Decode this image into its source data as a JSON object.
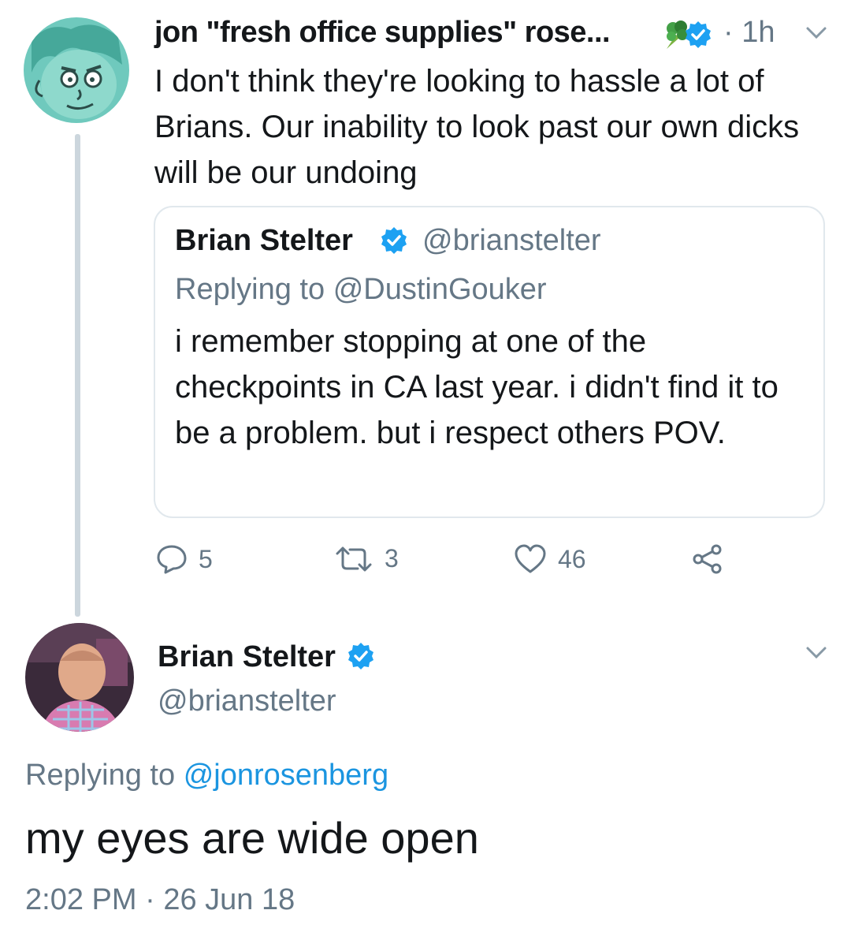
{
  "tweet1": {
    "display_name": "jon \"fresh office supplies\" rose...",
    "separator": "·",
    "time": "1h",
    "text": "I don't think they're looking to hassle a lot of Brians. Our inability to look past our own dicks will be our undoing",
    "quoted": {
      "display_name": "Brian Stelter",
      "handle": "@brianstelter",
      "replying_prefix": "Replying to",
      "replying_to": "@DustinGouker",
      "text": "i remember stopping at one of the checkpoints in CA last year. i didn't find it to be a problem. but i respect others POV."
    },
    "actions": {
      "replies": "5",
      "retweets": "3",
      "likes": "46"
    }
  },
  "tweet2": {
    "display_name": "Brian Stelter",
    "handle": "@brianstelter",
    "replying_prefix": "Replying to",
    "replying_to": "@jonrosenberg",
    "text": "my eyes are wide open",
    "time": "2:02 PM",
    "separator": "·",
    "date": "26 Jun 18"
  },
  "icons": [
    "chevron-down-icon",
    "verified-badge-icon",
    "broccoli-emoji-icon",
    "reply-icon",
    "retweet-icon",
    "like-icon",
    "share-icon"
  ],
  "colors": {
    "verified": "#1da1f2",
    "link": "#1b95e0",
    "secondary_text": "#657786",
    "border": "#e1e8ed"
  }
}
